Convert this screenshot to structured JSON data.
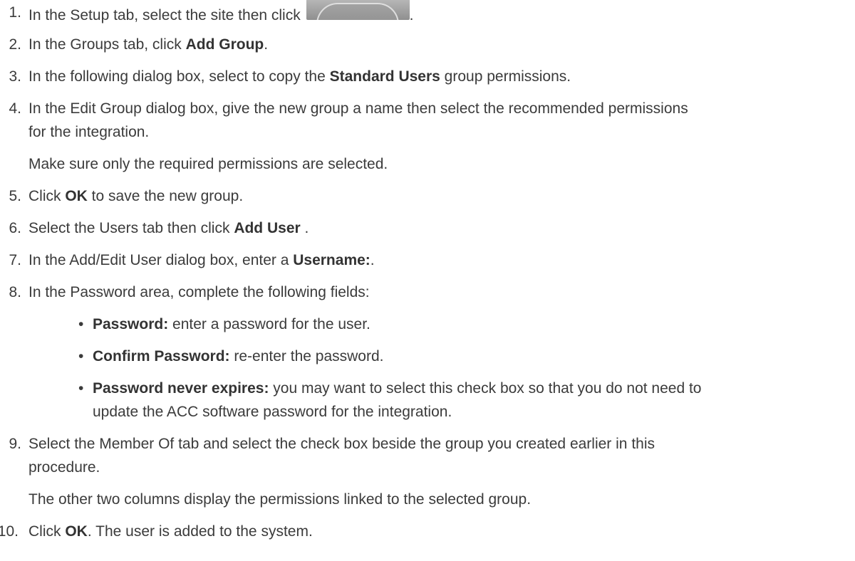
{
  "steps": [
    {
      "num": "1.",
      "before": "In the Setup tab, select the site then click",
      "after": ".",
      "button_icon": "site-button-icon"
    },
    {
      "num": "2.",
      "before": "In the Groups tab, click ",
      "bold": "Add Group",
      "after": "."
    },
    {
      "num": "3.",
      "before": "In the following dialog box, select to copy the ",
      "bold": "Standard Users",
      "after": " group permissions."
    },
    {
      "num": "4.",
      "line1": "In the Edit Group dialog box, give the new group a name then select the recommended permissions",
      "line2": "for the integration.",
      "note": "Make sure only the required permissions are selected."
    },
    {
      "num": "5.",
      "before": "Click ",
      "bold": "OK",
      "after": " to save the new group."
    },
    {
      "num": "6.",
      "before": "Select the Users tab then click ",
      "bold": "Add User",
      "after": " ."
    },
    {
      "num": "7.",
      "before": "In the Add/Edit User dialog box, enter a ",
      "bold": "Username:",
      "after": "."
    },
    {
      "num": "8.",
      "text": "In the Password area, complete the following fields:"
    },
    {
      "num": "9.",
      "line1": "Select the Member Of tab and select the check box beside the group you created earlier in this",
      "line2": "procedure.",
      "note": "The other two columns display the permissions linked to the selected group."
    },
    {
      "num": "10.",
      "before": "Click ",
      "bold": "OK",
      "after": ". The user is added to the system."
    }
  ],
  "password_fields": [
    {
      "bold": "Password:",
      "text": " enter a password for the user."
    },
    {
      "bold": "Confirm Password:",
      "text": " re-enter the password."
    },
    {
      "bold": "Password never expires:",
      "line1": " you may want to select this check box so that you do not need to",
      "line2": "update the ACC software password for the integration."
    }
  ],
  "bullet_char": "•"
}
